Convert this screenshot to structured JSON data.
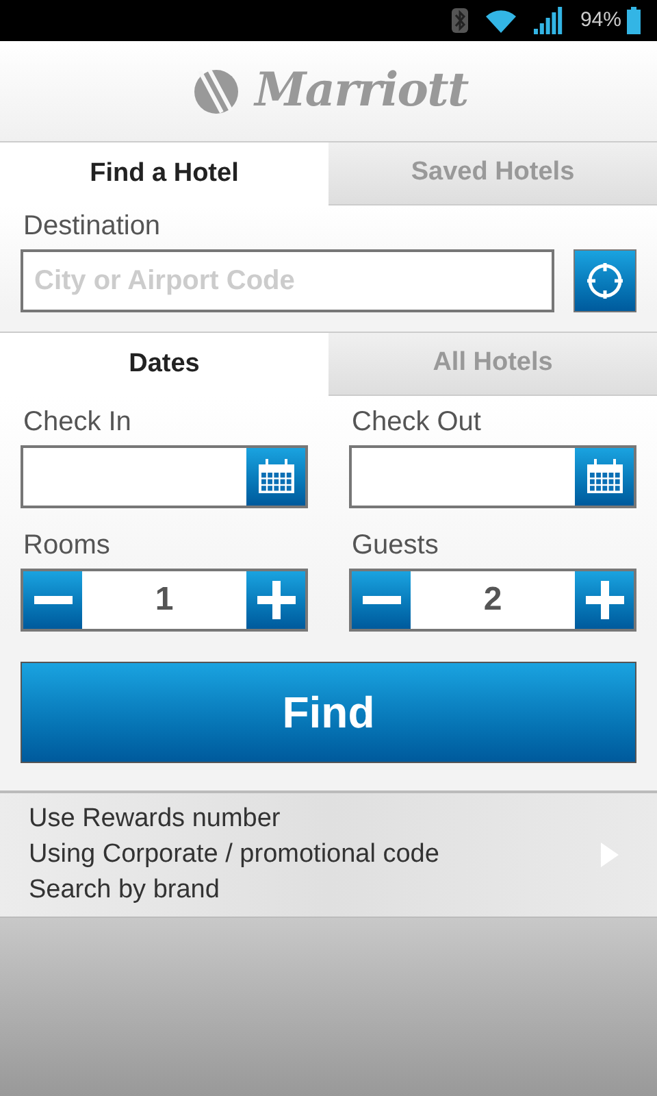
{
  "status_bar": {
    "battery": "94%"
  },
  "header": {
    "logo": "Marriott"
  },
  "tabs": [
    {
      "label": "Find a Hotel",
      "selected": true
    },
    {
      "label": "Saved Hotels",
      "selected": false
    }
  ],
  "destination": {
    "label": "Destination",
    "placeholder": "City or Airport Code"
  },
  "sub_tabs": [
    {
      "label": "Dates",
      "selected": true
    },
    {
      "label": "All Hotels",
      "selected": false
    }
  ],
  "dates": [
    {
      "label": "Check In"
    },
    {
      "label": "Check Out"
    }
  ],
  "counters": [
    {
      "label": "Rooms",
      "value": "1"
    },
    {
      "label": "Guests",
      "value": "2"
    }
  ],
  "find_button": "Find",
  "options": [
    "Use Rewards number",
    "Using Corporate / promotional code",
    "Search by brand"
  ]
}
